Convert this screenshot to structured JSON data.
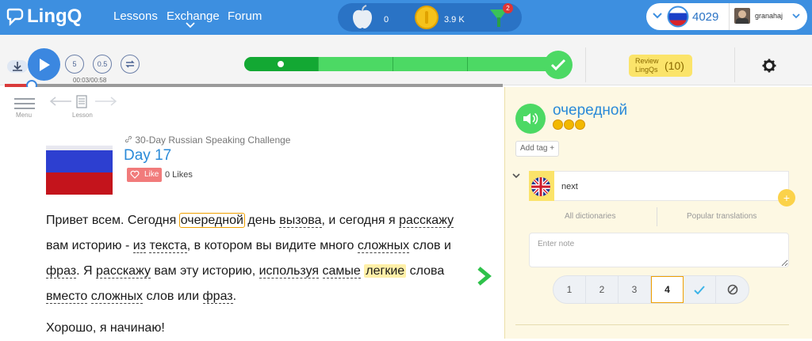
{
  "header": {
    "logo": "LingQ",
    "nav": [
      "Lessons",
      "Exchange",
      "Forum"
    ],
    "stats": {
      "apples": "0",
      "coins": "3.9 K",
      "streak_badge": "2"
    },
    "level_score": "4029",
    "username": "granahaj"
  },
  "player": {
    "rewind_label": "5",
    "speed_label": "0.5",
    "time": "00:03/00:58"
  },
  "review": {
    "label": "Review LingQs",
    "count": "(10)"
  },
  "lesson_meta": {
    "menu_label": "Menu",
    "lesson_label": "Lesson",
    "course": "30-Day Russian Speaking Challenge",
    "title": "Day 17",
    "like_label": "Like",
    "likes": "0 Likes"
  },
  "reader": {
    "p1": [
      {
        "t": "Привет"
      },
      {
        "t": " "
      },
      {
        "t": "всем"
      },
      {
        "t": ". "
      },
      {
        "t": "Сегодня"
      },
      {
        "t": " "
      },
      {
        "t": "очередной",
        "cls": "sel"
      },
      {
        "t": " "
      },
      {
        "t": "день"
      },
      {
        "t": " "
      },
      {
        "t": "вызова",
        "cls": "w"
      },
      {
        "t": ", "
      },
      {
        "t": "и"
      },
      {
        "t": " "
      },
      {
        "t": "сегодня"
      },
      {
        "t": " "
      },
      {
        "t": "я"
      },
      {
        "t": " "
      },
      {
        "t": "расскажу",
        "cls": "w"
      },
      {
        "t": " "
      },
      {
        "t": "вам"
      },
      {
        "t": " "
      },
      {
        "t": "историю"
      },
      {
        "t": " - "
      },
      {
        "t": "из",
        "cls": "w"
      },
      {
        "t": " "
      },
      {
        "t": "текста",
        "cls": "w"
      },
      {
        "t": ", "
      },
      {
        "t": "в"
      },
      {
        "t": " "
      },
      {
        "t": "котором"
      },
      {
        "t": " "
      },
      {
        "t": "вы"
      },
      {
        "t": " "
      },
      {
        "t": "видите"
      },
      {
        "t": " "
      },
      {
        "t": "много"
      },
      {
        "t": " "
      },
      {
        "t": "сложных",
        "cls": "w"
      },
      {
        "t": " "
      },
      {
        "t": "слов"
      },
      {
        "t": " "
      },
      {
        "t": "и"
      },
      {
        "t": " "
      },
      {
        "t": "фраз",
        "cls": "w"
      },
      {
        "t": ". "
      },
      {
        "t": "Я"
      },
      {
        "t": " "
      },
      {
        "t": "расскажу",
        "cls": "w"
      },
      {
        "t": " "
      },
      {
        "t": "вам"
      },
      {
        "t": " "
      },
      {
        "t": "эту"
      },
      {
        "t": " "
      },
      {
        "t": "историю"
      },
      {
        "t": ", "
      },
      {
        "t": "используя",
        "cls": "w"
      },
      {
        "t": " "
      },
      {
        "t": "самые",
        "cls": "w"
      },
      {
        "t": " "
      },
      {
        "t": "легкие",
        "cls": "lingq"
      },
      {
        "t": " "
      },
      {
        "t": "слова"
      },
      {
        "t": " "
      },
      {
        "t": "вместо",
        "cls": "w"
      },
      {
        "t": " "
      },
      {
        "t": "сложных",
        "cls": "w"
      },
      {
        "t": " "
      },
      {
        "t": "слов"
      },
      {
        "t": " "
      },
      {
        "t": "или"
      },
      {
        "t": " "
      },
      {
        "t": "фраз",
        "cls": "w"
      },
      {
        "t": "."
      }
    ],
    "p2": "Хорошо, я начинаю!"
  },
  "panel": {
    "term": "очередной",
    "add_tag": "Add tag +",
    "meaning": "next",
    "tab_dict": "All dictionaries",
    "tab_pop": "Popular translations",
    "note_placeholder": "Enter note",
    "statuses": [
      "1",
      "2",
      "3",
      "4"
    ]
  },
  "colors": {
    "accent": "#3d8fe0",
    "green": "#4cd964",
    "highlight": "#fff0a8"
  }
}
